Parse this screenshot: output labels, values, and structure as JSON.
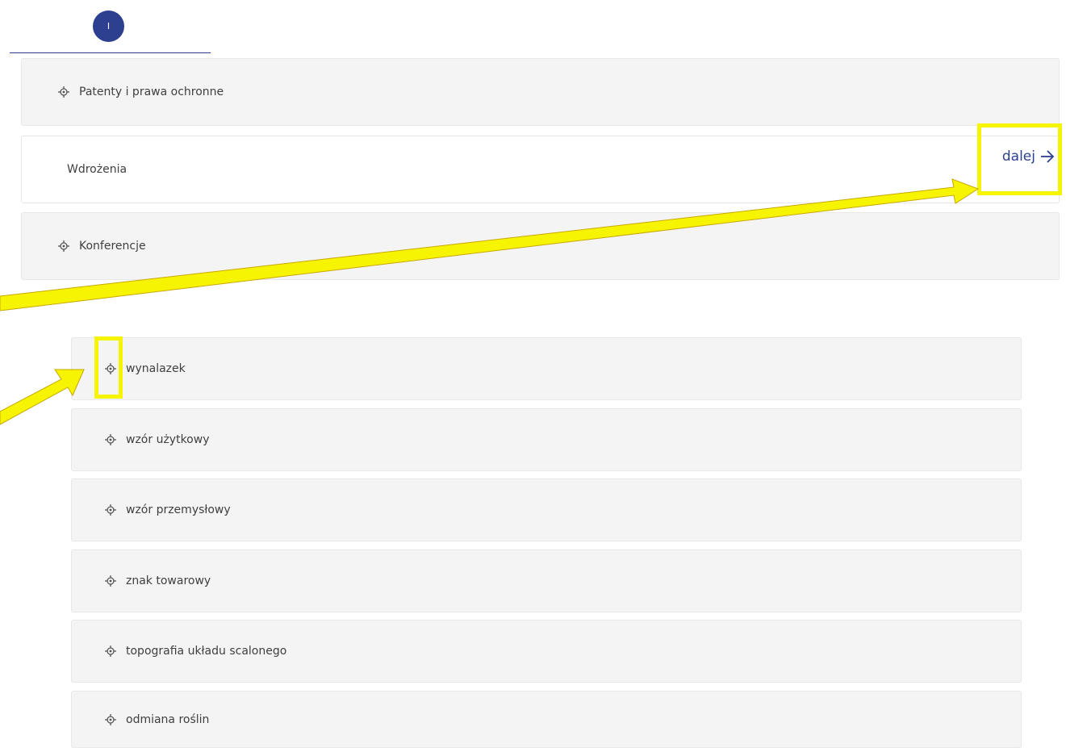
{
  "step": {
    "number": "I"
  },
  "sections": [
    {
      "label": "Patenty i prawa ochronne",
      "icon": "crosshair-icon"
    },
    {
      "label": "Wdrożenia",
      "icon": ""
    },
    {
      "label": "Konferencje",
      "icon": "crosshair-icon"
    }
  ],
  "next": {
    "label": "dalej",
    "icon": "arrow-right-icon"
  },
  "subitems": [
    {
      "label": "wynalazek",
      "icon": "crosshair-icon"
    },
    {
      "label": "wzór użytkowy",
      "icon": "crosshair-icon"
    },
    {
      "label": "wzór przemysłowy",
      "icon": "crosshair-icon"
    },
    {
      "label": "znak towarowy",
      "icon": "crosshair-icon"
    },
    {
      "label": "topografia układu scalonego",
      "icon": "crosshair-icon"
    },
    {
      "label": "odmiana roślin",
      "icon": "crosshair-icon"
    }
  ],
  "colors": {
    "accent": "#2d3f8f",
    "row_background": "#f4f4f4",
    "highlight": "#f6f400"
  }
}
